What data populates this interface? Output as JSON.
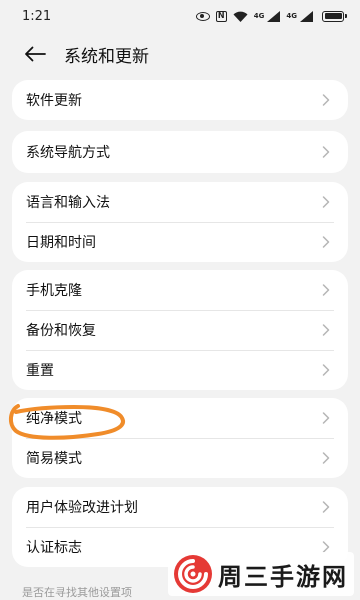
{
  "status_bar": {
    "time": "1:21",
    "net1": "4G",
    "net2": "4G"
  },
  "header": {
    "title": "系统和更新"
  },
  "groups": [
    {
      "items": [
        {
          "label": "软件更新"
        }
      ]
    },
    {
      "items": [
        {
          "label": "系统导航方式"
        }
      ]
    },
    {
      "items": [
        {
          "label": "语言和输入法"
        },
        {
          "label": "日期和时间"
        }
      ]
    },
    {
      "items": [
        {
          "label": "手机克隆"
        },
        {
          "label": "备份和恢复"
        },
        {
          "label": "重置"
        }
      ]
    },
    {
      "items": [
        {
          "label": "纯净模式"
        },
        {
          "label": "简易模式"
        }
      ]
    },
    {
      "items": [
        {
          "label": "用户体验改进计划"
        },
        {
          "label": "认证标志"
        }
      ]
    }
  ],
  "search_hint": "是否在寻找其他设置项",
  "watermark": {
    "text": "周三手游网"
  },
  "colors": {
    "background": "#f2f2f2",
    "card": "#ffffff",
    "annotation": "#f08c2a",
    "logo_red": "#e53935"
  },
  "icons": [
    "eye-icon",
    "nfc-icon",
    "wifi-icon",
    "signal-icon",
    "battery-icon",
    "back-arrow-icon",
    "chevron-right-icon"
  ]
}
